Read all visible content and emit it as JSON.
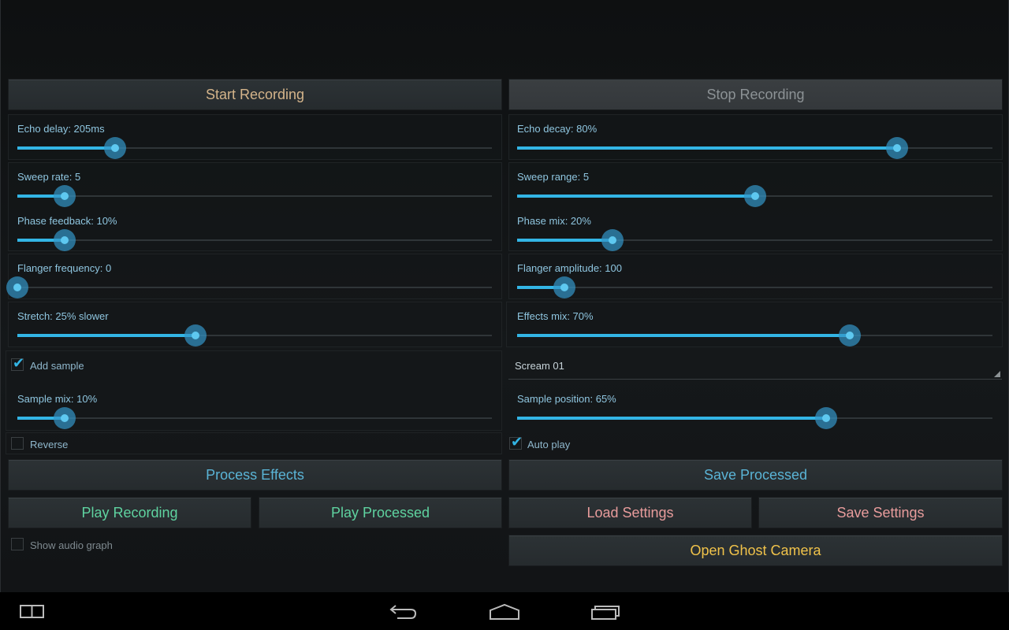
{
  "buttons": {
    "start_recording": "Start Recording",
    "stop_recording": "Stop Recording",
    "process_effects": "Process Effects",
    "save_processed": "Save Processed",
    "play_recording": "Play Recording",
    "play_processed": "Play Processed",
    "load_settings": "Load Settings",
    "save_settings": "Save Settings",
    "open_ghost_camera": "Open Ghost Camera"
  },
  "colors": {
    "start": "#d4b48a",
    "stop": "#8c9295",
    "process": "#5ab4d6",
    "play": "#5fd3a0",
    "settings": "#e89c9c",
    "ghost": "#f0c24a",
    "accent": "#33b5e5"
  },
  "sliders": [
    {
      "label": "Echo delay: 205ms",
      "value": 0.206
    },
    {
      "label": "Echo decay: 80%",
      "value": 0.8
    },
    {
      "label": "Sweep rate: 5",
      "value": 0.1
    },
    {
      "label": "Sweep range: 5",
      "value": 0.5
    },
    {
      "label": "Phase feedback: 10%",
      "value": 0.1
    },
    {
      "label": "Phase mix: 20%",
      "value": 0.2
    },
    {
      "label": "Flanger frequency: 0",
      "value": 0
    },
    {
      "label": "Flanger amplitude: 100",
      "value": 0.1
    },
    {
      "label": "Stretch: 25% slower",
      "value": 0.375
    },
    {
      "label": "Effects mix: 70%",
      "value": 0.7
    },
    {
      "label": "Sample mix: 10%",
      "value": 0.1
    },
    {
      "label": "Sample position: 65%",
      "value": 0.65
    }
  ],
  "checkboxes": {
    "add_sample": {
      "label": "Add sample",
      "checked": true
    },
    "reverse": {
      "label": "Reverse",
      "checked": false
    },
    "auto_play": {
      "label": "Auto play",
      "checked": true
    },
    "show_audio_graph": {
      "label": "Show audio graph",
      "checked": false
    }
  },
  "sample_select": {
    "value": "Scream 01"
  },
  "navbar": {
    "icons": [
      "recent-apps-icon",
      "back-icon",
      "home-icon",
      "recents-icon"
    ]
  }
}
